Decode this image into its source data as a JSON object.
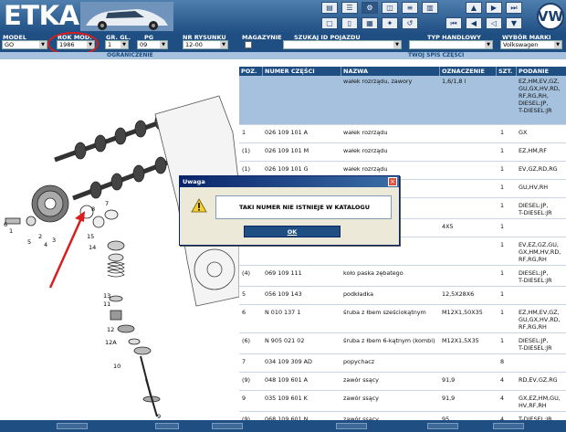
{
  "app": {
    "title": "ETKA",
    "brand_logo": "VW"
  },
  "toolbar": {
    "icons": [
      "printer-icon",
      "list-icon",
      "bike-icon",
      "camera-icon",
      "list-detail-icon",
      "book-icon",
      "monitor-icon",
      "page-icon",
      "grid-icon",
      "pin-icon",
      "back-icon",
      "first-icon",
      "prev-icon",
      "prev-frame-icon",
      "up-icon",
      "down-icon",
      "next-icon",
      "last-icon"
    ]
  },
  "filters": {
    "model_label": "MODEL",
    "model_value": "GO",
    "year_label": "ROK MOD.",
    "year_value": "1986",
    "group_label": "GR. GL.",
    "group_value": "1",
    "pg_label": "PG",
    "pg_value": "09",
    "drawing_label": "NR RYSUNKU",
    "drawing_value": "12-00",
    "magazine_label": "MAGAZYNIE",
    "search_vehicle_label": "SZUKAJ ID POJAZDU",
    "trade_type_label": "TYP HANDLOWY",
    "brand_label": "WYBÓR MARKI",
    "brand_value": "Volkswagen"
  },
  "subbar": {
    "restriction": "OGRANICZENIE",
    "contents": "TWÓJ SPIS CZĘŚCI"
  },
  "table": {
    "columns": [
      "POZ.",
      "NUMER CZĘŚCI",
      "NAZWA",
      "OZNACZENIE",
      "SZT.",
      "PODANIE MODELU"
    ],
    "rows": [
      {
        "poz": "",
        "numer": "",
        "nazwa": "wałek rozrządu, zawory",
        "ozn": "1,6/1,8 l",
        "szt": "",
        "model": "EZ,HM,EV,GZ,\nGU,GX,HV,RD,\nRF,RG,RH,\nDIESEL:JP,\nT-DIESEL:JR",
        "group": true
      },
      {
        "poz": "1",
        "numer": "026 109 101 A",
        "nazwa": "wałek rozrządu",
        "ozn": "",
        "szt": "1",
        "model": "GX",
        "group": false
      },
      {
        "poz": "(1)",
        "numer": "026 109 101 M",
        "nazwa": "wałek rozrządu",
        "ozn": "",
        "szt": "1",
        "model": "EZ,HM,RF",
        "group": false
      },
      {
        "poz": "(1)",
        "numer": "026 109 101 G",
        "nazwa": "wałek rozrządu",
        "ozn": "",
        "szt": "1",
        "model": "EV,GZ,RD,RG",
        "group": false
      },
      {
        "poz": "",
        "numer": "",
        "nazwa": "",
        "ozn": "",
        "szt": "1",
        "model": "GU,HV,RH",
        "group": false
      },
      {
        "poz": "",
        "numer": "",
        "nazwa": "",
        "ozn": "",
        "szt": "1",
        "model": "DIESEL:JP,\nT-DIESEL:JR",
        "group": false
      },
      {
        "poz": "",
        "numer": "",
        "nazwa": "",
        "ozn": "4X5",
        "szt": "1",
        "model": "",
        "group": false
      },
      {
        "poz": "",
        "numer": "",
        "nazwa": "eba",
        "ozn": "",
        "szt": "1",
        "model": "EV,EZ,GZ,GU,\nGX,HM,HV,RD,\nRF,RG,RH",
        "group": false
      },
      {
        "poz": "(4)",
        "numer": "069 109 111",
        "nazwa": "koło paska zębatego",
        "ozn": "",
        "szt": "1",
        "model": "DIESEL:JP,\nT-DIESEL:JR",
        "group": false
      },
      {
        "poz": "5",
        "numer": "056 109 143",
        "nazwa": "podkładka",
        "ozn": "12,5X28X6",
        "szt": "1",
        "model": "",
        "group": false
      },
      {
        "poz": "6",
        "numer": "N     010 137 1",
        "nazwa": "śruba z łbem sześciokątnym",
        "ozn": "M12X1,50X35",
        "szt": "1",
        "model": "EZ,HM,EV,GZ,\nGU,GX,HV,RD,\nRF,RG,RH",
        "group": false
      },
      {
        "poz": "(6)",
        "numer": "N     905 021 02",
        "nazwa": "śruba z łbem 6-kątnym (kombi)",
        "ozn": "M12X1,5X35",
        "szt": "1",
        "model": "DIESEL:JP,\nT-DIESEL:JR",
        "group": false
      },
      {
        "poz": "7",
        "numer": "034 109 309 AD",
        "nazwa": "popychacz",
        "ozn": "",
        "szt": "8",
        "model": "",
        "group": false
      },
      {
        "poz": "(9)",
        "numer": "048 109 601 A",
        "nazwa": "zawór ssący",
        "ozn": "91,9",
        "szt": "4",
        "model": "RD,EV,GZ,RG",
        "group": false
      },
      {
        "poz": "9",
        "numer": "035 109 601 K",
        "nazwa": "zawór ssący",
        "ozn": "91,9",
        "szt": "4",
        "model": "GX,EZ,HM,GU,\nHV,RF,RH",
        "group": false
      },
      {
        "poz": "(9)",
        "numer": "068 109 601 N",
        "nazwa": "zawór ssący",
        "ozn": "95",
        "szt": "4",
        "model": "T-DIESEL:JR",
        "group": false
      }
    ]
  },
  "diagram_labels": [
    "1",
    "2",
    "3",
    "4",
    "5",
    "6",
    "7",
    "8",
    "9",
    "10",
    "11",
    "12",
    "12A",
    "13",
    "14",
    "15"
  ],
  "dialog": {
    "title": "Uwaga",
    "message": "TAKI NUMER NIE ISTNIEJE W KATALOGU",
    "ok": "OK"
  },
  "colors": {
    "header_blue": "#1f4e82",
    "group_row": "#a5c1dd",
    "highlight_red": "#d81e1e"
  }
}
